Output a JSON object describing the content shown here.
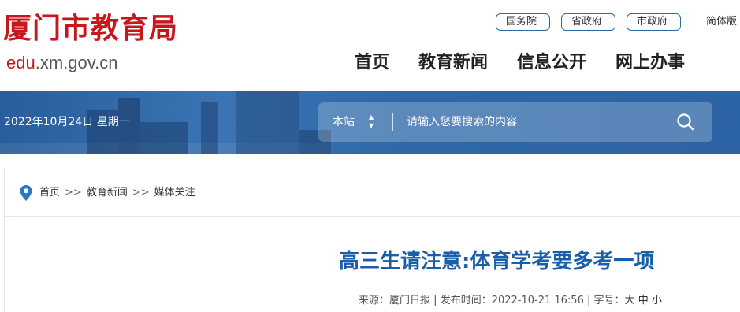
{
  "header": {
    "logo_cn": "厦门市教育局",
    "logo_url_prefix": "edu",
    "logo_url_rest": ".xm.gov.cn",
    "gov_links": [
      "国务院",
      "省政府",
      "市政府"
    ],
    "lang_switch": "简体版",
    "nav": [
      "首页",
      "教育新闻",
      "信息公开",
      "网上办事"
    ]
  },
  "banner": {
    "date": "2022年10月24日 星期一",
    "search_scope": "本站",
    "search_placeholder": "请输入您要搜索的内容",
    "search_icon": "search-icon"
  },
  "breadcrumb": {
    "icon": "location-pin-icon",
    "items": [
      "首页",
      "教育新闻",
      "媒体关注"
    ],
    "separator": ">>"
  },
  "article": {
    "title": "高三生请注意:体育学考要多考一项",
    "source_label": "来源：",
    "source": "厦门日报",
    "publish_label": "发布时间：",
    "publish_time": "2022-10-21 16:56",
    "font_label": "字号：",
    "font_sizes": [
      "大",
      "中",
      "小"
    ]
  },
  "colors": {
    "brand_red": "#c8161d",
    "banner_blue": "#2f68a8",
    "title_blue": "#1a5ea8",
    "link_border": "#2a6aa8"
  }
}
